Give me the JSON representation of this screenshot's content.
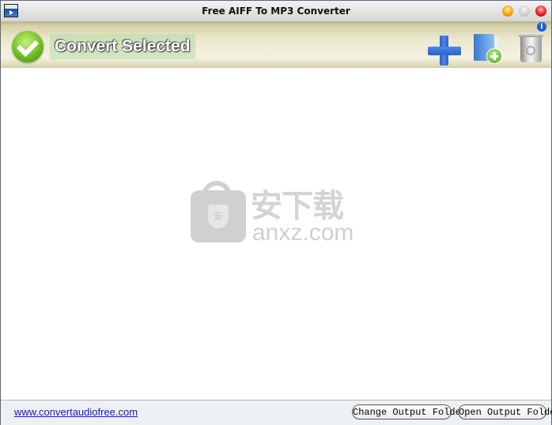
{
  "window": {
    "title": "Free AIFF To MP3 Converter",
    "app_icon": "clapperboard-icon",
    "controls": [
      "minimize",
      "maximize",
      "close"
    ]
  },
  "toolbar": {
    "convert_label": "Convert Selected",
    "info_glyph": "i",
    "icons": [
      "checkmark-icon",
      "add-plus-icon",
      "add-file-icon",
      "recycle-bin-icon",
      "info-icon"
    ]
  },
  "watermark": {
    "chinese": "安下载",
    "latin": "anxz.com",
    "shield_glyph": "安"
  },
  "status": {
    "website_link": "www.convertaudiofree.com",
    "change_output_label": "Change Output Folder",
    "open_output_label": "Open Output Folder"
  }
}
